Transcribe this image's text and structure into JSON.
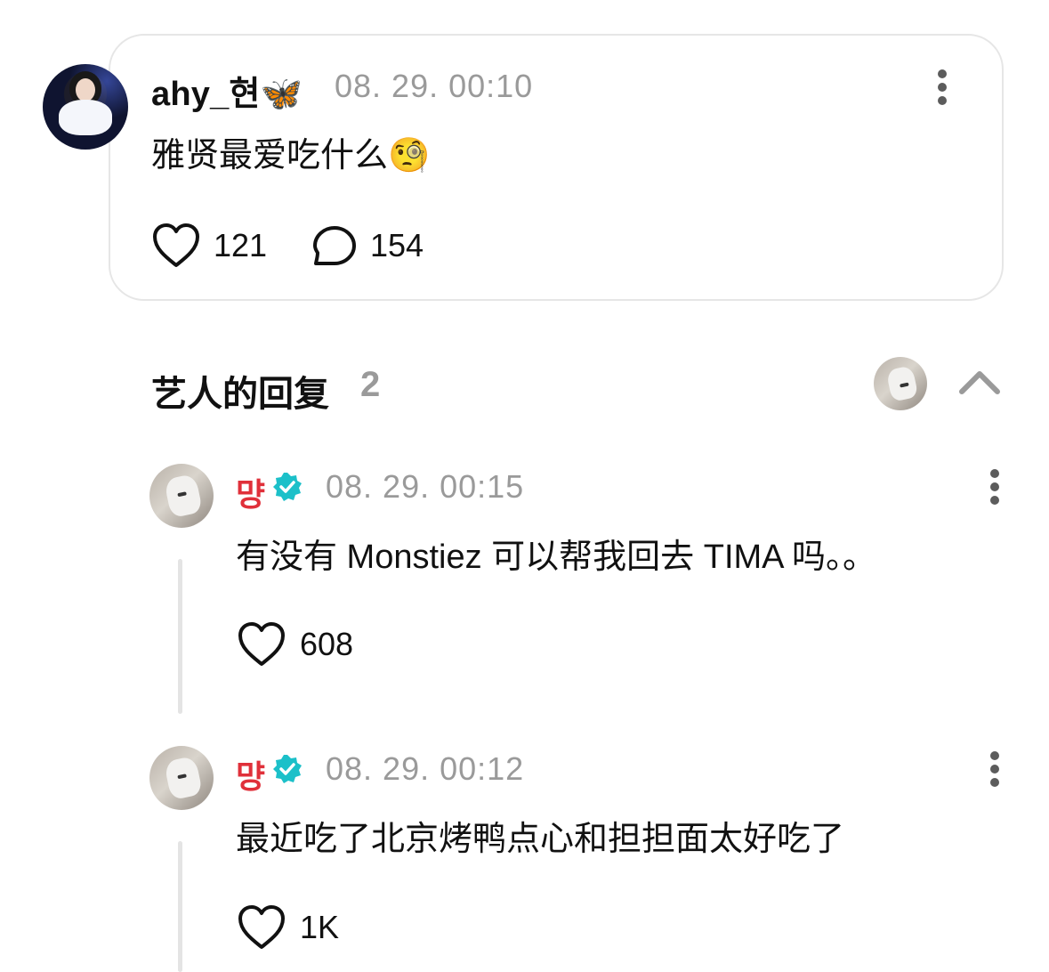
{
  "post": {
    "username": "ahy_현🦋",
    "timestamp": "08. 29. 00:10",
    "text": "雅贤最爱吃什么🧐",
    "likes": "121",
    "comments": "154"
  },
  "artist_replies": {
    "title": "艺人的回复",
    "count": "2"
  },
  "replies": [
    {
      "username": "먕",
      "timestamp": "08. 29. 00:15",
      "text": "有没有 Monstiez 可以帮我回去 TIMA 吗。。",
      "likes": "608"
    },
    {
      "username": "먕",
      "timestamp": "08. 29. 00:12",
      "text": "最近吃了北京烤鸭点心和担担面太好吃了",
      "likes": "1K"
    }
  ],
  "colors": {
    "verified": "#1cc0c9",
    "artist_name": "#e0303a",
    "muted": "#9a9a9a"
  },
  "icons": [
    "heart-icon",
    "comment-icon",
    "more-options-icon",
    "verified-badge-icon",
    "chevron-up-icon"
  ]
}
